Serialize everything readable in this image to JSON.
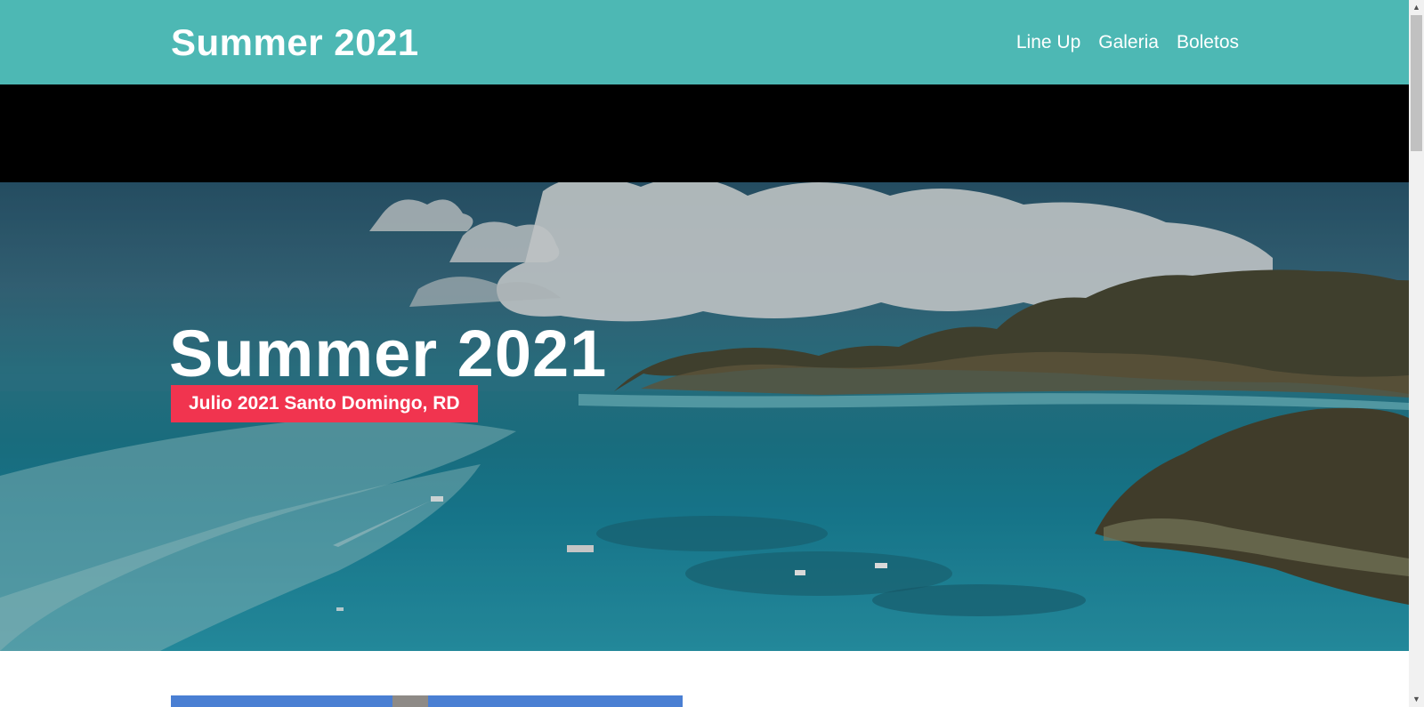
{
  "header": {
    "logo": "Summer 2021",
    "nav": [
      {
        "label": "Line Up"
      },
      {
        "label": "Galeria"
      },
      {
        "label": "Boletos"
      }
    ],
    "background_color": "#4db8b4"
  },
  "hero": {
    "title": "Summer 2021",
    "badge": "Julio 2021 Santo Domingo, RD",
    "badge_color": "#f1344f",
    "background_icon": "tropical-island-photo"
  },
  "content": {
    "image_icon": "building-photo"
  }
}
